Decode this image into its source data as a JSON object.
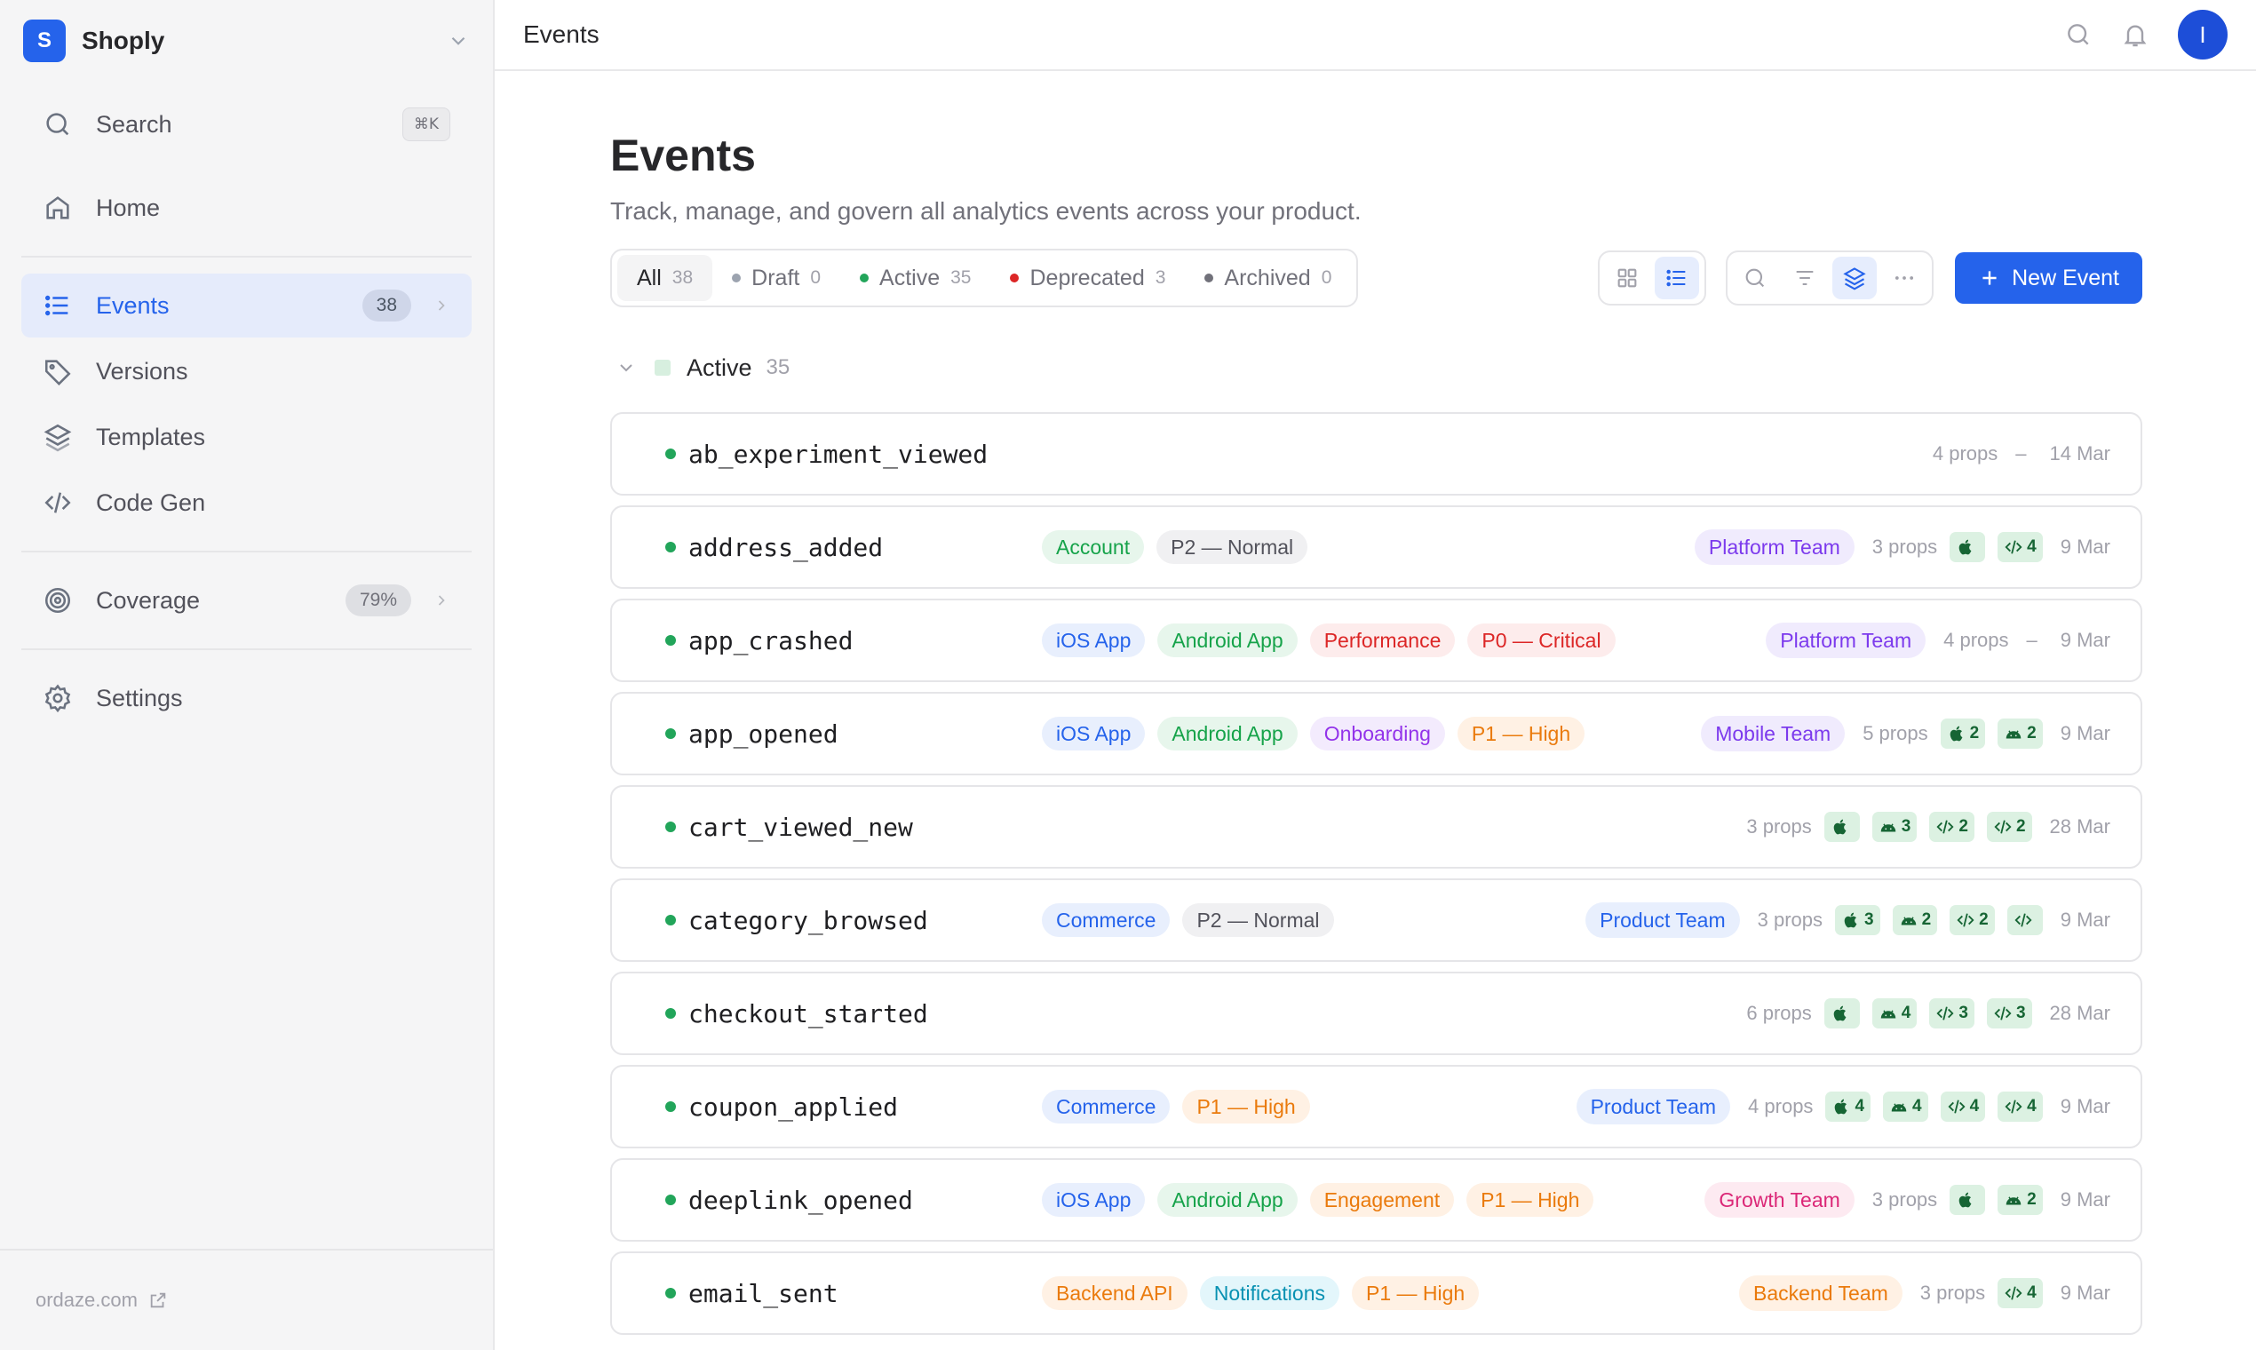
{
  "workspace": {
    "initial": "S",
    "name": "Shoply"
  },
  "sidebar": {
    "search": {
      "label": "Search",
      "shortcut": "⌘K"
    },
    "items": [
      {
        "label": "Home",
        "icon": "home-icon"
      },
      {
        "label": "Events",
        "icon": "list-icon",
        "count": "38",
        "active": true
      },
      {
        "label": "Versions",
        "icon": "tag-icon"
      },
      {
        "label": "Templates",
        "icon": "layers-icon"
      },
      {
        "label": "Code Gen",
        "icon": "code-icon"
      },
      {
        "label": "Coverage",
        "icon": "target-icon",
        "count": "79%"
      },
      {
        "label": "Settings",
        "icon": "gear-icon"
      }
    ],
    "footer": "ordaze.com"
  },
  "topbar": {
    "title": "Events",
    "avatar_initial": "I"
  },
  "page": {
    "title": "Events",
    "subtitle": "Track, manage, and govern all analytics events across your product.",
    "new_button": "New Event"
  },
  "filters": [
    {
      "label": "All",
      "count": "38",
      "selected": true
    },
    {
      "label": "Draft",
      "count": "0",
      "dot": "#9ca3af"
    },
    {
      "label": "Active",
      "count": "35",
      "dot": "#22a55a"
    },
    {
      "label": "Deprecated",
      "count": "3",
      "dot": "#dc2626"
    },
    {
      "label": "Archived",
      "count": "0",
      "dot": "#71717a"
    }
  ],
  "group": {
    "label": "Active",
    "count": "35"
  },
  "events": [
    {
      "name": "ab_experiment_viewed",
      "tags": [],
      "team": null,
      "props": "4 props",
      "platforms": [],
      "dash": "–",
      "date": "14 Mar"
    },
    {
      "name": "address_added",
      "tags": [
        {
          "t": "Account",
          "c": "green"
        },
        {
          "t": "P2 — Normal",
          "c": "gray"
        }
      ],
      "team": {
        "t": "Platform Team",
        "c": "violet"
      },
      "props": "3 props",
      "platforms": [
        {
          "k": "apple",
          "n": ""
        },
        {
          "k": "code",
          "n": "4"
        }
      ],
      "date": "9 Mar"
    },
    {
      "name": "app_crashed",
      "tags": [
        {
          "t": "iOS App",
          "c": "blue"
        },
        {
          "t": "Android App",
          "c": "green"
        },
        {
          "t": "Performance",
          "c": "red"
        },
        {
          "t": "P0 — Critical",
          "c": "red"
        }
      ],
      "team": {
        "t": "Platform Team",
        "c": "violet"
      },
      "props": "4 props",
      "platforms": [],
      "dash": "–",
      "date": "9 Mar"
    },
    {
      "name": "app_opened",
      "tags": [
        {
          "t": "iOS App",
          "c": "blue"
        },
        {
          "t": "Android App",
          "c": "green"
        },
        {
          "t": "Onboarding",
          "c": "purple"
        },
        {
          "t": "P1 — High",
          "c": "orange"
        }
      ],
      "team": {
        "t": "Mobile Team",
        "c": "violet"
      },
      "props": "5 props",
      "platforms": [
        {
          "k": "apple",
          "n": "2"
        },
        {
          "k": "android",
          "n": "2"
        }
      ],
      "date": "9 Mar"
    },
    {
      "name": "cart_viewed_new",
      "tags": [],
      "team": null,
      "props": "3 props",
      "platforms": [
        {
          "k": "apple",
          "n": ""
        },
        {
          "k": "android",
          "n": "3"
        },
        {
          "k": "code",
          "n": "2"
        },
        {
          "k": "code",
          "n": "2"
        }
      ],
      "date": "28 Mar"
    },
    {
      "name": "category_browsed",
      "tags": [
        {
          "t": "Commerce",
          "c": "blue"
        },
        {
          "t": "P2 — Normal",
          "c": "gray"
        }
      ],
      "team": {
        "t": "Product Team",
        "c": "blue"
      },
      "props": "3 props",
      "platforms": [
        {
          "k": "apple",
          "n": "3"
        },
        {
          "k": "android",
          "n": "2"
        },
        {
          "k": "code",
          "n": "2"
        },
        {
          "k": "code",
          "n": ""
        }
      ],
      "date": "9 Mar"
    },
    {
      "name": "checkout_started",
      "tags": [],
      "team": null,
      "props": "6 props",
      "platforms": [
        {
          "k": "apple",
          "n": ""
        },
        {
          "k": "android",
          "n": "4"
        },
        {
          "k": "code",
          "n": "3"
        },
        {
          "k": "code",
          "n": "3"
        }
      ],
      "date": "28 Mar"
    },
    {
      "name": "coupon_applied",
      "tags": [
        {
          "t": "Commerce",
          "c": "blue"
        },
        {
          "t": "P1 — High",
          "c": "orange"
        }
      ],
      "team": {
        "t": "Product Team",
        "c": "blue"
      },
      "props": "4 props",
      "platforms": [
        {
          "k": "apple",
          "n": "4"
        },
        {
          "k": "android",
          "n": "4"
        },
        {
          "k": "code",
          "n": "4"
        },
        {
          "k": "code",
          "n": "4"
        }
      ],
      "date": "9 Mar"
    },
    {
      "name": "deeplink_opened",
      "tags": [
        {
          "t": "iOS App",
          "c": "blue"
        },
        {
          "t": "Android App",
          "c": "green"
        },
        {
          "t": "Engagement",
          "c": "orange"
        },
        {
          "t": "P1 — High",
          "c": "orange"
        }
      ],
      "team": {
        "t": "Growth Team",
        "c": "pink"
      },
      "props": "3 props",
      "platforms": [
        {
          "k": "apple",
          "n": ""
        },
        {
          "k": "android",
          "n": "2"
        }
      ],
      "date": "9 Mar"
    },
    {
      "name": "email_sent",
      "tags": [
        {
          "t": "Backend API",
          "c": "orange"
        },
        {
          "t": "Notifications",
          "c": "cyan"
        },
        {
          "t": "P1 — High",
          "c": "orange"
        }
      ],
      "team": {
        "t": "Backend Team",
        "c": "orange"
      },
      "props": "3 props",
      "platforms": [
        {
          "k": "code",
          "n": "4"
        }
      ],
      "date": "9 Mar"
    }
  ]
}
